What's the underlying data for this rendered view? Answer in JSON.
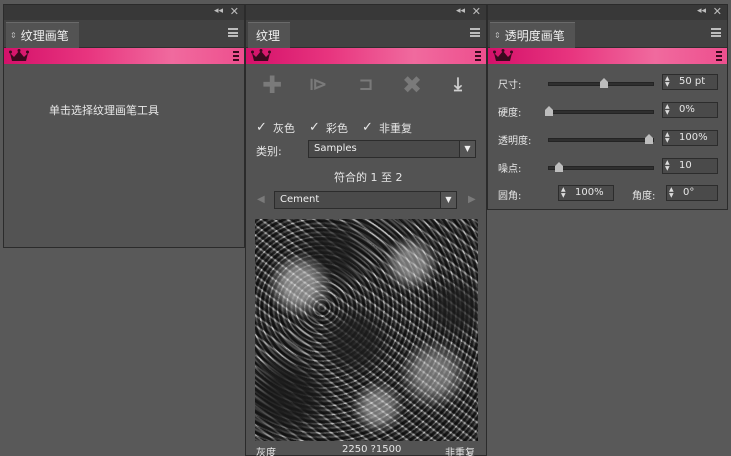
{
  "panel_left": {
    "tab": "纹理画笔",
    "hint": "单击选择纹理画笔工具"
  },
  "panel_middle": {
    "tab": "纹理",
    "checks": [
      {
        "label": "灰色",
        "checked": true
      },
      {
        "label": "彩色",
        "checked": true
      },
      {
        "label": "非重复",
        "checked": true
      }
    ],
    "category_label": "类别:",
    "category_value": "Samples",
    "match_text": "符合的 1 至 2",
    "texture_name": "Cement",
    "footer_left": "灰度",
    "footer_mid": "2250 ?1500",
    "footer_right": "非重复"
  },
  "panel_right": {
    "tab": "透明度画笔",
    "rows": [
      {
        "label": "尺寸:",
        "value": "50 pt",
        "level": 0.55
      },
      {
        "label": "硬度:",
        "value": "0%",
        "level": 0.0
      },
      {
        "label": "透明度:",
        "value": "100%",
        "level": 1.0
      },
      {
        "label": "噪点:",
        "value": "10",
        "level": 0.1
      }
    ],
    "round_label": "圆角:",
    "round_value": "100%",
    "angle_label": "角度:",
    "angle_value": "0°"
  },
  "icons": [
    "collapse-icon",
    "close-icon",
    "panel-menu-icon",
    "crown-icon",
    "add-icon",
    "import-icon",
    "rename-icon",
    "delete-icon",
    "save-icon"
  ],
  "colors": {
    "accent_pink": "#e8357f",
    "panel_bg": "#535353"
  }
}
